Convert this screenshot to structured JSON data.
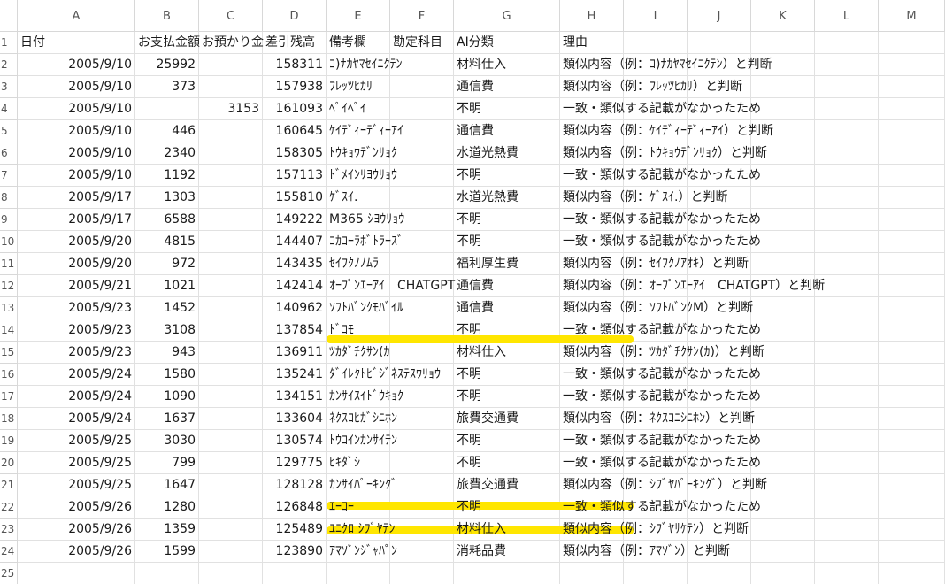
{
  "columns": [
    "A",
    "B",
    "C",
    "D",
    "E",
    "F",
    "G",
    "H",
    "I",
    "J",
    "K",
    "L",
    "M"
  ],
  "header_row": [
    "日付",
    "お支払金額",
    "お預かり金",
    "差引残高",
    "備考欄",
    "勘定科目",
    "AI分類",
    "理由"
  ],
  "rows": [
    {
      "date": "2005/9/10",
      "pay": "25992",
      "dep": "",
      "bal": "158311",
      "memo": "ｺ)ﾅｶﾔﾏｾｲﾆｸﾃﾝ",
      "acct": "",
      "ai": "材料仕入",
      "reason": "類似内容（例：ｺ)ﾅｶﾔﾏｾｲﾆｸﾃﾝ）と判断"
    },
    {
      "date": "2005/9/10",
      "pay": "373",
      "dep": "",
      "bal": "157938",
      "memo": "ﾌﾚｯﾂﾋｶﾘ",
      "acct": "",
      "ai": "通信費",
      "reason": "類似内容（例：ﾌﾚｯﾂﾋｶﾘ）と判断"
    },
    {
      "date": "2005/9/10",
      "pay": "",
      "dep": "3153",
      "bal": "161093",
      "memo": "ﾍﾟｲﾍﾟｲ",
      "acct": "",
      "ai": "不明",
      "reason": "一致・類似する記載がなかったため"
    },
    {
      "date": "2005/9/10",
      "pay": "446",
      "dep": "",
      "bal": "160645",
      "memo": "ｹｲﾃﾞｨｰﾃﾞｨｰｱｲ",
      "acct": "",
      "ai": "通信費",
      "reason": "類似内容（例：ｹｲﾃﾞｨｰﾃﾞｨｰｱｲ）と判断"
    },
    {
      "date": "2005/9/10",
      "pay": "2340",
      "dep": "",
      "bal": "158305",
      "memo": "ﾄｳｷｮｳﾃﾞﾝﾘｮｸ",
      "acct": "",
      "ai": "水道光熱費",
      "reason": "類似内容（例：ﾄｳｷｮｳﾃﾞﾝﾘｮｸ）と判断"
    },
    {
      "date": "2005/9/10",
      "pay": "1192",
      "dep": "",
      "bal": "157113",
      "memo": "ﾄﾞﾒｲﾝﾘﾖｳﾘｮｳ",
      "acct": "",
      "ai": "不明",
      "reason": "一致・類似する記載がなかったため"
    },
    {
      "date": "2005/9/17",
      "pay": "1303",
      "dep": "",
      "bal": "155810",
      "memo": "ｹﾞｽｲ.",
      "acct": "",
      "ai": "水道光熱費",
      "reason": "類似内容（例：ｹﾞｽｲ.）と判断"
    },
    {
      "date": "2005/9/17",
      "pay": "6588",
      "dep": "",
      "bal": "149222",
      "memo": "M365 ｼﾖｳﾘｮｳ",
      "acct": "",
      "ai": "不明",
      "reason": "一致・類似する記載がなかったため"
    },
    {
      "date": "2005/9/20",
      "pay": "4815",
      "dep": "",
      "bal": "144407",
      "memo": "ｺｶｺｰﾗﾎﾞﾄﾗｰｽﾞ",
      "acct": "",
      "ai": "不明",
      "reason": "一致・類似する記載がなかったため"
    },
    {
      "date": "2005/9/20",
      "pay": "972",
      "dep": "",
      "bal": "143435",
      "memo": "ｾｲﾌｸﾉﾉﾑﾗ",
      "acct": "",
      "ai": "福利厚生費",
      "reason": "類似内容（例：ｾｲﾌｸﾉｱｵｷ）と判断"
    },
    {
      "date": "2005/9/21",
      "pay": "1021",
      "dep": "",
      "bal": "142414",
      "memo": "ｵｰﾌﾟﾝｴｰｱｲ　CHATGPT",
      "acct": "",
      "ai": "通信費",
      "reason": "類似内容（例：ｵｰﾌﾟﾝｴｰｱｲ　CHATGPT）と判断"
    },
    {
      "date": "2005/9/23",
      "pay": "1452",
      "dep": "",
      "bal": "140962",
      "memo": "ｿﾌﾄﾊﾞﾝｸﾓﾊﾞｲﾙ",
      "acct": "",
      "ai": "通信費",
      "reason": "類似内容（例：ｿﾌﾄﾊﾞﾝｸM）と判断"
    },
    {
      "date": "2005/9/23",
      "pay": "3108",
      "dep": "",
      "bal": "137854",
      "memo": "ﾄﾞｺﾓ",
      "acct": "",
      "ai": "不明",
      "reason": "一致・類似する記載がなかったため"
    },
    {
      "date": "2005/9/23",
      "pay": "943",
      "dep": "",
      "bal": "136911",
      "memo": "ﾂｶﾀﾞﾁｸｻﾝ(ｶ",
      "acct": "",
      "ai": "材料仕入",
      "reason": "類似内容（例：ﾂｶﾀﾞﾁｸｻﾝ(ｶ)）と判断"
    },
    {
      "date": "2005/9/24",
      "pay": "1580",
      "dep": "",
      "bal": "135241",
      "memo": "ﾀﾞｲﾚｸﾄﾋﾞｼﾞﾈｽﾃｽｳﾘｮｳ",
      "acct": "",
      "ai": "不明",
      "reason": "一致・類似する記載がなかったため"
    },
    {
      "date": "2005/9/24",
      "pay": "1090",
      "dep": "",
      "bal": "134151",
      "memo": "ｶﾝｻｲｽｲﾄﾞｳｷｮｸ",
      "acct": "",
      "ai": "不明",
      "reason": "一致・類似する記載がなかったため"
    },
    {
      "date": "2005/9/24",
      "pay": "1637",
      "dep": "",
      "bal": "133604",
      "memo": "ﾈｸｽｺﾋｶﾞｼﾆﾎﾝ",
      "acct": "",
      "ai": "旅費交通費",
      "reason": "類似内容（例：ﾈｸｽｺﾆｼﾆﾎﾝ）と判断"
    },
    {
      "date": "2005/9/25",
      "pay": "3030",
      "dep": "",
      "bal": "130574",
      "memo": "ﾄｳｺｲﾝｶﾝｻｲﾃﾝ",
      "acct": "",
      "ai": "不明",
      "reason": "一致・類似する記載がなかったため"
    },
    {
      "date": "2005/9/25",
      "pay": "799",
      "dep": "",
      "bal": "129775",
      "memo": "ﾋｷﾀﾞｼ",
      "acct": "",
      "ai": "不明",
      "reason": "一致・類似する記載がなかったため"
    },
    {
      "date": "2005/9/25",
      "pay": "1647",
      "dep": "",
      "bal": "128128",
      "memo": "ｶﾝｻｲﾊﾟｰｷﾝｸﾞ",
      "acct": "",
      "ai": "旅費交通費",
      "reason": "類似内容（例：ｼﾌﾞﾔﾊﾟｰｷﾝｸﾞ）と判断"
    },
    {
      "date": "2005/9/26",
      "pay": "1280",
      "dep": "",
      "bal": "126848",
      "memo": "ｴｰｺｰ",
      "acct": "",
      "ai": "不明",
      "reason": "一致・類似する記載がなかったため"
    },
    {
      "date": "2005/9/26",
      "pay": "1359",
      "dep": "",
      "bal": "125489",
      "memo": "ﾕﾆｸﾛ ｼﾌﾞﾔﾃﾝ",
      "acct": "",
      "ai": "材料仕入",
      "reason": "類似内容（例：ｼﾌﾞﾔｻｹﾃﾝ）と判断"
    },
    {
      "date": "2005/9/26",
      "pay": "1599",
      "dep": "",
      "bal": "123890",
      "memo": "ｱﾏｿﾞﾝｼﾞｬﾊﾟﾝ",
      "acct": "",
      "ai": "消耗品費",
      "reason": "類似内容（例：ｱﾏｿﾞﾝ）と判断"
    }
  ],
  "highlight_color": "#ffe600"
}
